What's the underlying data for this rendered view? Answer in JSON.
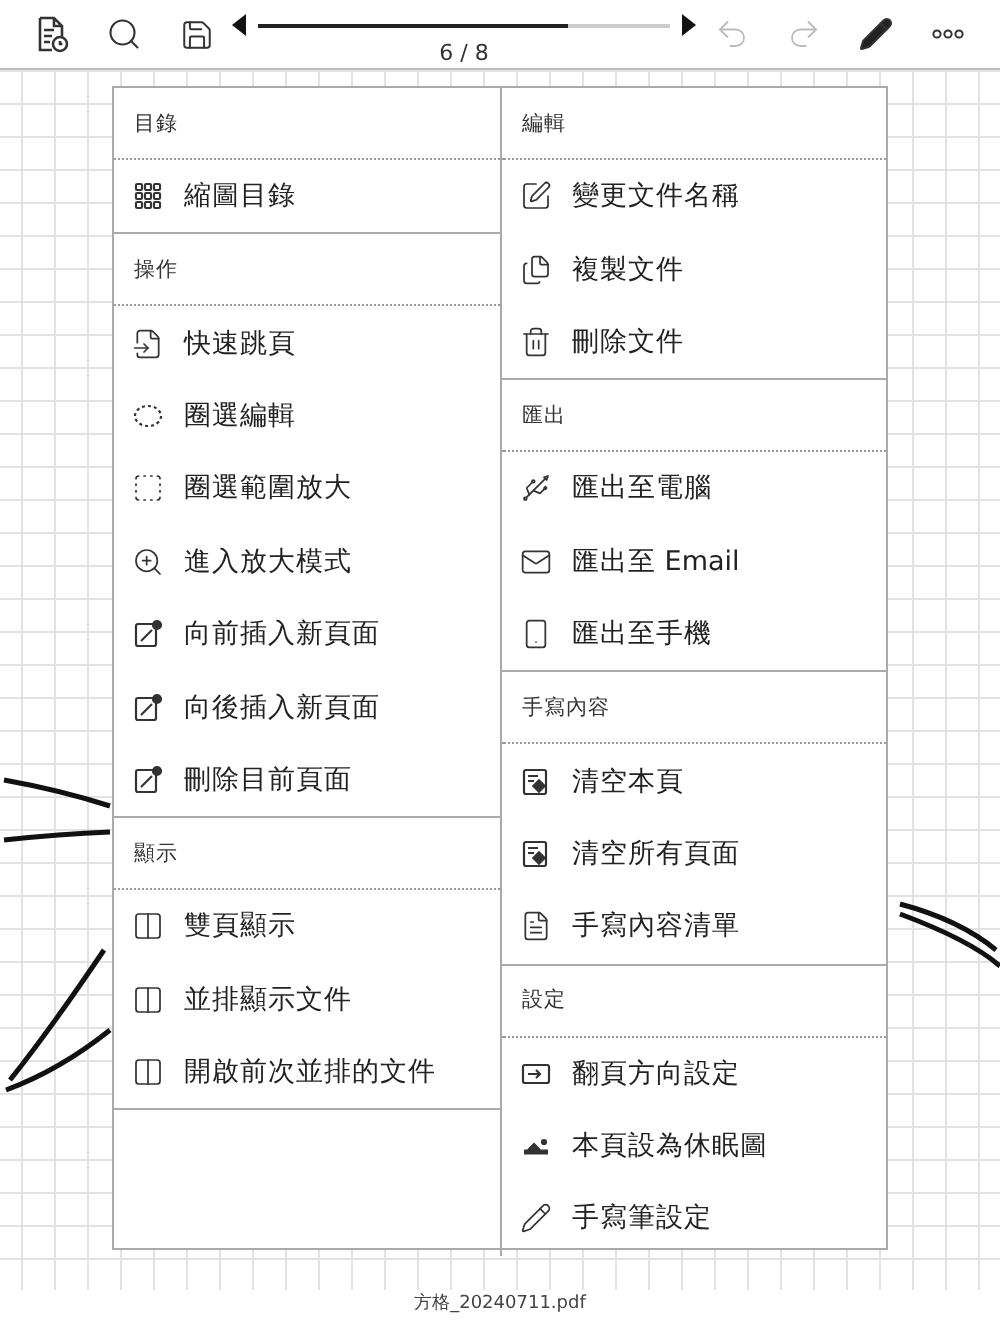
{
  "toolbar": {
    "undo": {
      "disabled": true
    },
    "redo": {
      "disabled": true
    },
    "page_slider": {
      "level": 0.75
    },
    "page_indicator": "6 / 8"
  },
  "menu": {
    "columns": [
      {
        "sections": [
          {
            "title": "目錄",
            "items": [
              "縮圖目錄"
            ]
          },
          {
            "title": "操作",
            "items": [
              "快速跳頁",
              "圈選編輯",
              "圈選範圍放大",
              "進入放大模式",
              "向前插入新頁面",
              "向後插入新頁面",
              "刪除目前頁面"
            ]
          },
          {
            "title": "顯示",
            "items": [
              "雙頁顯示",
              "並排顯示文件",
              "開啟前次並排的文件"
            ]
          }
        ]
      },
      {
        "sections": [
          {
            "title": "編輯",
            "items": [
              "變更文件名稱",
              "複製文件",
              "刪除文件"
            ]
          },
          {
            "title": "匯出",
            "items": [
              "匯出至電腦",
              "匯出至 Email",
              "匯出至手機"
            ]
          },
          {
            "title": "手寫內容",
            "items": [
              "清空本頁",
              "清空所有頁面",
              "手寫內容清單"
            ]
          },
          {
            "title": "設定",
            "items": [
              "翻頁方向設定",
              "本頁設為休眠圖",
              "手寫筆設定"
            ]
          }
        ]
      }
    ]
  },
  "footer": {
    "filename": "方格_20240711.pdf"
  }
}
